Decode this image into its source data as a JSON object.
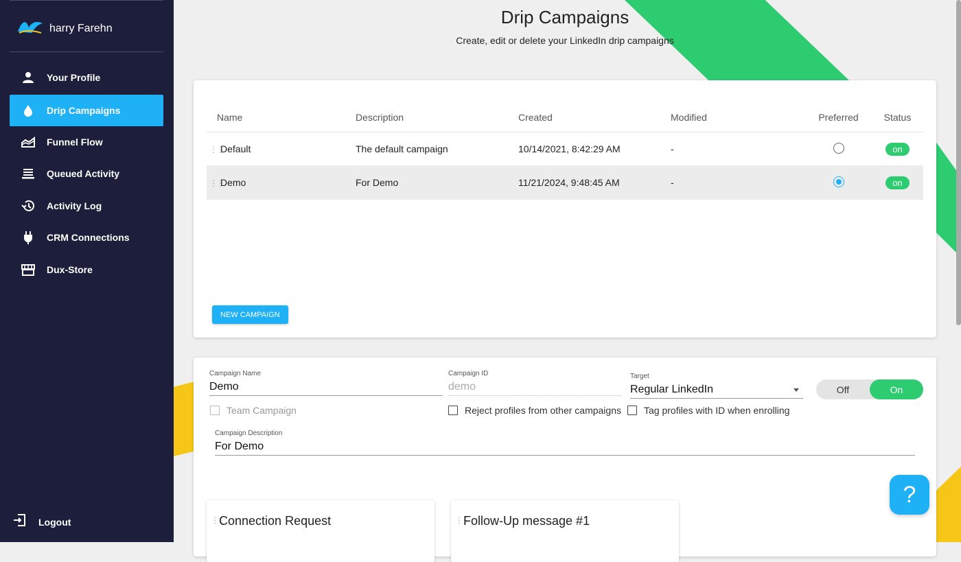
{
  "sidebar": {
    "user_name": "harry Farehn",
    "items": [
      {
        "label": "Your Profile",
        "icon": "person-icon",
        "active": false
      },
      {
        "label": "Drip Campaigns",
        "icon": "drop-icon",
        "active": true
      },
      {
        "label": "Funnel Flow",
        "icon": "chart-area-icon",
        "active": false
      },
      {
        "label": "Queued Activity",
        "icon": "queue-icon",
        "active": false
      },
      {
        "label": "Activity Log",
        "icon": "history-icon",
        "active": false
      },
      {
        "label": "CRM Connections",
        "icon": "plug-icon",
        "active": false
      },
      {
        "label": "Dux-Store",
        "icon": "store-icon",
        "active": false
      }
    ],
    "logout_label": "Logout"
  },
  "header": {
    "title": "Drip Campaigns",
    "subtitle": "Create, edit or delete your LinkedIn drip campaigns"
  },
  "campaigns_table": {
    "columns": [
      "Name",
      "Description",
      "Created",
      "Modified",
      "Preferred",
      "Status"
    ],
    "rows": [
      {
        "name": "Default",
        "description": "The default campaign",
        "created": "10/14/2021, 8:42:29 AM",
        "modified": "-",
        "preferred": false,
        "status": "on"
      },
      {
        "name": "Demo",
        "description": "For Demo",
        "created": "11/21/2024, 9:48:45 AM",
        "modified": "-",
        "preferred": true,
        "status": "on"
      }
    ],
    "new_button": "NEW CAMPAIGN"
  },
  "editor": {
    "name_label": "Campaign Name",
    "name_value": "Demo",
    "id_label": "Campaign ID",
    "id_value": "demo",
    "target_label": "Target",
    "target_value": "Regular LinkedIn",
    "toggle_off": "Off",
    "toggle_on": "On",
    "team_campaign": "Team Campaign",
    "reject_profiles": "Reject profiles from other campaigns",
    "tag_profiles": "Tag profiles with ID when enrolling",
    "description_label": "Campaign Description",
    "description_value": "For Demo",
    "steps": [
      "Connection Request",
      "Follow-Up message #1"
    ]
  },
  "help_button": "?",
  "colors": {
    "sidebar": "#1c1e3b",
    "accent": "#1eb1f5",
    "green": "#2ecc71",
    "yellow": "#f5c518"
  }
}
